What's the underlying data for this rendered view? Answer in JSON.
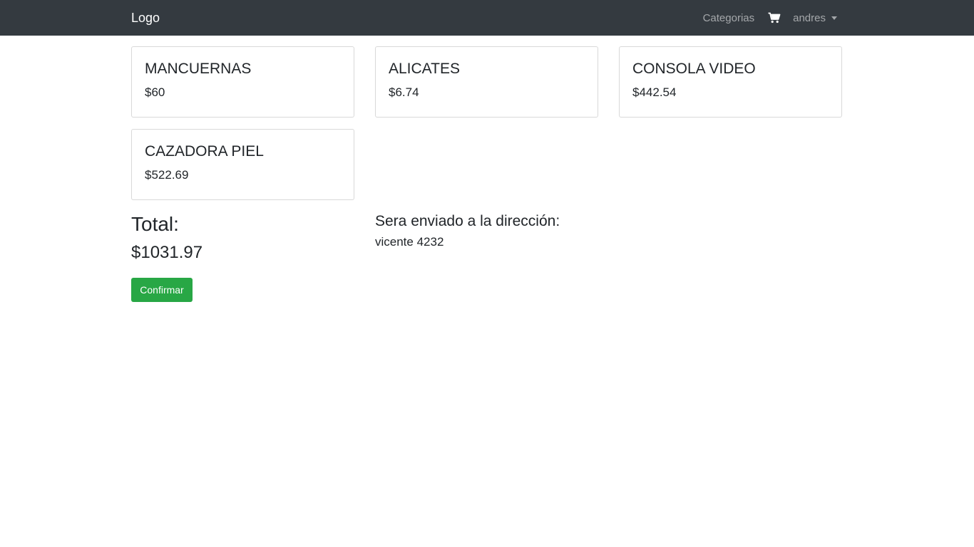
{
  "navbar": {
    "brand": "Logo",
    "categories_label": "Categorias",
    "cart_icon": "shopping-cart-icon",
    "user_label": "andres",
    "background": "#343a40"
  },
  "cart_items": [
    {
      "name": "MANCUERNAS",
      "price": "$60"
    },
    {
      "name": "ALICATES",
      "price": "$6.74"
    },
    {
      "name": "CONSOLA VIDEO",
      "price": "$442.54"
    },
    {
      "name": "CAZADORA PIEL",
      "price": "$522.69"
    }
  ],
  "summary": {
    "total_label": "Total:",
    "total_value": "$1031.97",
    "confirm_label": "Confirmar",
    "confirm_color": "#28a745"
  },
  "shipping": {
    "label": "Sera enviado a la dirección:",
    "address": "vicente 4232"
  }
}
